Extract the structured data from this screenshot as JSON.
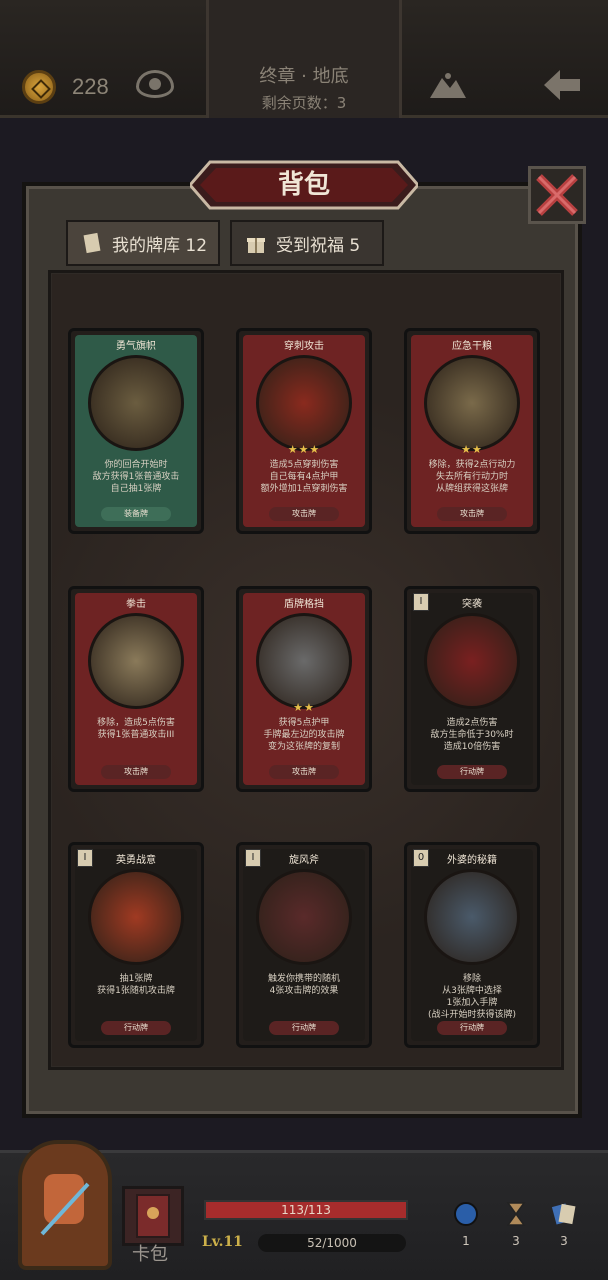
{
  "header": {
    "gold": "228",
    "chapter_title": "终章 · 地底",
    "pages_left": "剩余页数：3"
  },
  "bag": {
    "title": "背包",
    "tabs": [
      {
        "label": "我的牌库 12",
        "active": true
      },
      {
        "label": "受到祝福 5",
        "active": false
      }
    ]
  },
  "cards": [
    {
      "name": "勇气旗帜",
      "desc": "你的回合开始时\n敌方获得1张普通攻击\n自己抽1张牌",
      "type": "装备牌",
      "stars": "",
      "cost": "",
      "theme": "green"
    },
    {
      "name": "穿刺攻击",
      "desc": "造成5点穿刺伤害\n自己每有4点护甲\n额外增加1点穿刺伤害",
      "type": "攻击牌",
      "stars": "★★★",
      "cost": "",
      "theme": "red"
    },
    {
      "name": "应急干粮",
      "desc": "移除，获得2点行动力\n失去所有行动力时\n从牌组获得这张牌",
      "type": "攻击牌",
      "stars": "★★",
      "cost": "",
      "theme": "red"
    },
    {
      "name": "拳击",
      "desc": "移除，造成5点伤害\n获得1张普通攻击III",
      "type": "攻击牌",
      "stars": "",
      "cost": "",
      "theme": "red"
    },
    {
      "name": "盾牌格挡",
      "desc": "获得5点护甲\n手牌最左边的攻击牌\n变为这张牌的复制",
      "type": "攻击牌",
      "stars": "★★",
      "cost": "",
      "theme": "red"
    },
    {
      "name": "突袭",
      "desc": "造成2点伤害\n敌方生命低于30%时\n造成10倍伤害",
      "type": "行动牌",
      "stars": "",
      "cost": "I",
      "theme": "black"
    },
    {
      "name": "英勇战意",
      "desc": "抽1张牌\n获得1张随机攻击牌",
      "type": "行动牌",
      "stars": "",
      "cost": "I",
      "theme": "black"
    },
    {
      "name": "旋风斧",
      "desc": "触发你携带的随机\n4张攻击牌的效果",
      "type": "行动牌",
      "stars": "",
      "cost": "I",
      "theme": "black"
    },
    {
      "name": "外婆的秘籍",
      "desc": "移除\n从3张牌中选择\n1张加入手牌\n(战斗开始时获得该牌)",
      "type": "行动牌",
      "stars": "",
      "cost": "0",
      "theme": "black"
    }
  ],
  "hud": {
    "deck_label": "卡包",
    "hp_text": "113/113",
    "level": "Lv.11",
    "exp_text": "52/1000",
    "resources": [
      {
        "icon": "potion-icon",
        "count": "1"
      },
      {
        "icon": "hourglass-icon",
        "count": "3"
      },
      {
        "icon": "cards-icon",
        "count": "3"
      }
    ]
  },
  "colors": {
    "green_frame": "#2f5a48",
    "red_frame": "#6e2323",
    "black_frame": "#1e1b18",
    "accent_gold": "#e0a33a",
    "hp_red": "#a62c2c"
  }
}
